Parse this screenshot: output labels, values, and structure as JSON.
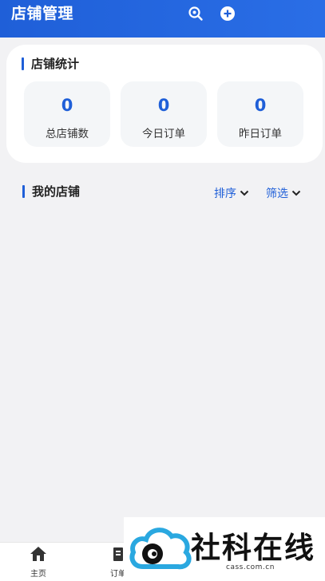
{
  "header": {
    "title": "店铺管理",
    "icons": [
      "search-icon",
      "add-icon"
    ]
  },
  "stats": {
    "title": "店铺统计",
    "items": [
      {
        "value": "0",
        "label": "总店铺数"
      },
      {
        "value": "0",
        "label": "今日订单"
      },
      {
        "value": "0",
        "label": "昨日订单"
      }
    ]
  },
  "my_stores": {
    "title": "我的店铺",
    "sort_label": "排序",
    "filter_label": "筛选"
  },
  "tabbar": {
    "items": [
      {
        "label": "主页",
        "icon": "home-icon"
      },
      {
        "label": "订单",
        "icon": "orders-icon"
      }
    ]
  },
  "watermark": {
    "text": "社科在线",
    "sub": "cass.com.cn"
  },
  "colors": {
    "primary": "#1f5fd8",
    "background": "#f2f2f4",
    "card": "#ffffff"
  }
}
